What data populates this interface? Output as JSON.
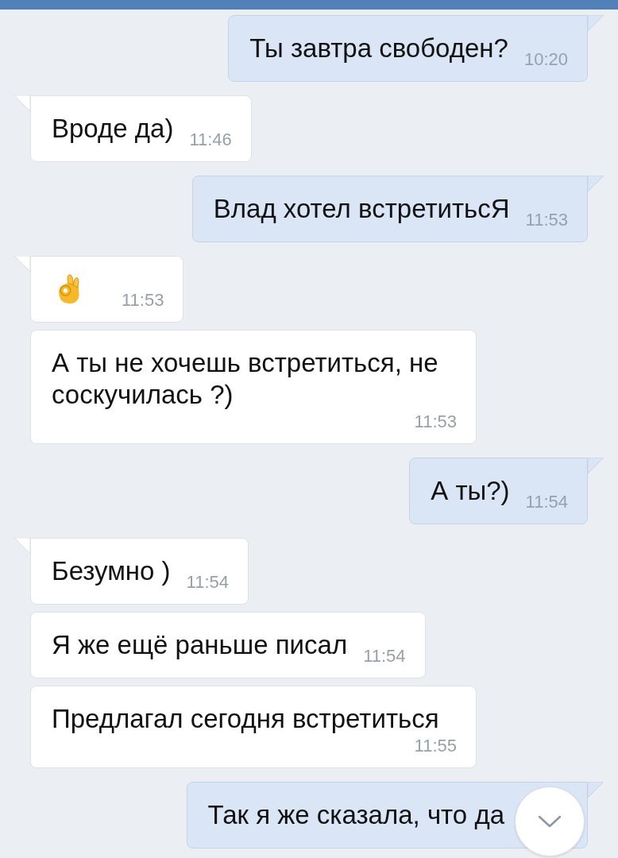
{
  "messages": [
    {
      "outgoing": true,
      "kind": "text",
      "text": "Ты завтра свободен?",
      "time": "10:20"
    },
    {
      "outgoing": false,
      "kind": "text",
      "text": "Вроде да)",
      "time": "11:46"
    },
    {
      "outgoing": true,
      "kind": "text",
      "text": "Влад хотел встретитьсЯ",
      "time": "11:53"
    },
    {
      "outgoing": false,
      "kind": "emoji",
      "time": "11:53"
    },
    {
      "outgoing": false,
      "kind": "text",
      "text": "А ты не хочешь встретиться, не соскучилась ?)",
      "time": "11:53"
    },
    {
      "outgoing": true,
      "kind": "text",
      "text": "А ты?)",
      "time": "11:54"
    },
    {
      "outgoing": false,
      "kind": "text",
      "text": "Безумно )",
      "time": "11:54"
    },
    {
      "outgoing": false,
      "kind": "text",
      "text": "Я же ещё раньше писал",
      "time": "11:54"
    },
    {
      "outgoing": false,
      "kind": "text",
      "text": "Предлагал сегодня встретиться",
      "time": "11:55"
    },
    {
      "outgoing": true,
      "kind": "text",
      "text": "Так я же сказала, что да"
    }
  ]
}
